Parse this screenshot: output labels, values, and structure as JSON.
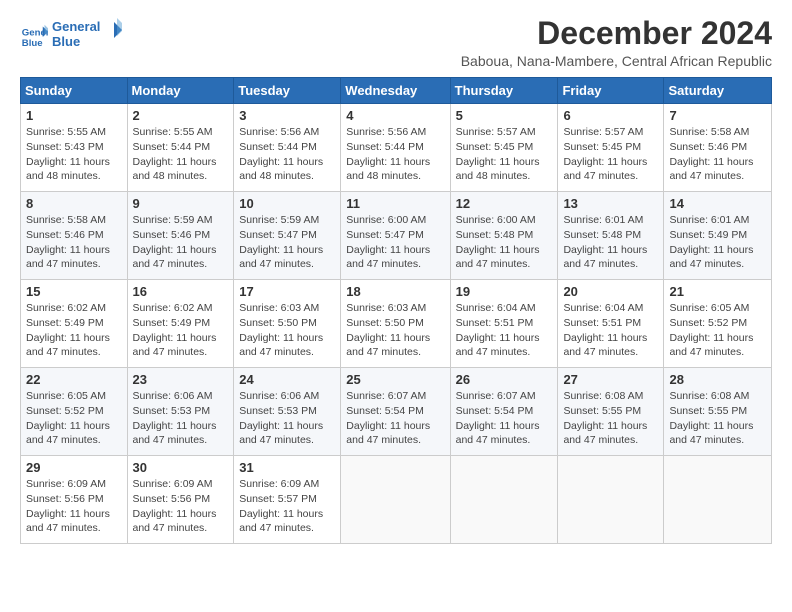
{
  "logo": {
    "line1": "General",
    "line2": "Blue"
  },
  "title": "December 2024",
  "subtitle": "Baboua, Nana-Mambere, Central African Republic",
  "weekdays": [
    "Sunday",
    "Monday",
    "Tuesday",
    "Wednesday",
    "Thursday",
    "Friday",
    "Saturday"
  ],
  "weeks": [
    [
      {
        "day": "1",
        "info": "Sunrise: 5:55 AM\nSunset: 5:43 PM\nDaylight: 11 hours\nand 48 minutes."
      },
      {
        "day": "2",
        "info": "Sunrise: 5:55 AM\nSunset: 5:44 PM\nDaylight: 11 hours\nand 48 minutes."
      },
      {
        "day": "3",
        "info": "Sunrise: 5:56 AM\nSunset: 5:44 PM\nDaylight: 11 hours\nand 48 minutes."
      },
      {
        "day": "4",
        "info": "Sunrise: 5:56 AM\nSunset: 5:44 PM\nDaylight: 11 hours\nand 48 minutes."
      },
      {
        "day": "5",
        "info": "Sunrise: 5:57 AM\nSunset: 5:45 PM\nDaylight: 11 hours\nand 48 minutes."
      },
      {
        "day": "6",
        "info": "Sunrise: 5:57 AM\nSunset: 5:45 PM\nDaylight: 11 hours\nand 47 minutes."
      },
      {
        "day": "7",
        "info": "Sunrise: 5:58 AM\nSunset: 5:46 PM\nDaylight: 11 hours\nand 47 minutes."
      }
    ],
    [
      {
        "day": "8",
        "info": "Sunrise: 5:58 AM\nSunset: 5:46 PM\nDaylight: 11 hours\nand 47 minutes."
      },
      {
        "day": "9",
        "info": "Sunrise: 5:59 AM\nSunset: 5:46 PM\nDaylight: 11 hours\nand 47 minutes."
      },
      {
        "day": "10",
        "info": "Sunrise: 5:59 AM\nSunset: 5:47 PM\nDaylight: 11 hours\nand 47 minutes."
      },
      {
        "day": "11",
        "info": "Sunrise: 6:00 AM\nSunset: 5:47 PM\nDaylight: 11 hours\nand 47 minutes."
      },
      {
        "day": "12",
        "info": "Sunrise: 6:00 AM\nSunset: 5:48 PM\nDaylight: 11 hours\nand 47 minutes."
      },
      {
        "day": "13",
        "info": "Sunrise: 6:01 AM\nSunset: 5:48 PM\nDaylight: 11 hours\nand 47 minutes."
      },
      {
        "day": "14",
        "info": "Sunrise: 6:01 AM\nSunset: 5:49 PM\nDaylight: 11 hours\nand 47 minutes."
      }
    ],
    [
      {
        "day": "15",
        "info": "Sunrise: 6:02 AM\nSunset: 5:49 PM\nDaylight: 11 hours\nand 47 minutes."
      },
      {
        "day": "16",
        "info": "Sunrise: 6:02 AM\nSunset: 5:49 PM\nDaylight: 11 hours\nand 47 minutes."
      },
      {
        "day": "17",
        "info": "Sunrise: 6:03 AM\nSunset: 5:50 PM\nDaylight: 11 hours\nand 47 minutes."
      },
      {
        "day": "18",
        "info": "Sunrise: 6:03 AM\nSunset: 5:50 PM\nDaylight: 11 hours\nand 47 minutes."
      },
      {
        "day": "19",
        "info": "Sunrise: 6:04 AM\nSunset: 5:51 PM\nDaylight: 11 hours\nand 47 minutes."
      },
      {
        "day": "20",
        "info": "Sunrise: 6:04 AM\nSunset: 5:51 PM\nDaylight: 11 hours\nand 47 minutes."
      },
      {
        "day": "21",
        "info": "Sunrise: 6:05 AM\nSunset: 5:52 PM\nDaylight: 11 hours\nand 47 minutes."
      }
    ],
    [
      {
        "day": "22",
        "info": "Sunrise: 6:05 AM\nSunset: 5:52 PM\nDaylight: 11 hours\nand 47 minutes."
      },
      {
        "day": "23",
        "info": "Sunrise: 6:06 AM\nSunset: 5:53 PM\nDaylight: 11 hours\nand 47 minutes."
      },
      {
        "day": "24",
        "info": "Sunrise: 6:06 AM\nSunset: 5:53 PM\nDaylight: 11 hours\nand 47 minutes."
      },
      {
        "day": "25",
        "info": "Sunrise: 6:07 AM\nSunset: 5:54 PM\nDaylight: 11 hours\nand 47 minutes."
      },
      {
        "day": "26",
        "info": "Sunrise: 6:07 AM\nSunset: 5:54 PM\nDaylight: 11 hours\nand 47 minutes."
      },
      {
        "day": "27",
        "info": "Sunrise: 6:08 AM\nSunset: 5:55 PM\nDaylight: 11 hours\nand 47 minutes."
      },
      {
        "day": "28",
        "info": "Sunrise: 6:08 AM\nSunset: 5:55 PM\nDaylight: 11 hours\nand 47 minutes."
      }
    ],
    [
      {
        "day": "29",
        "info": "Sunrise: 6:09 AM\nSunset: 5:56 PM\nDaylight: 11 hours\nand 47 minutes."
      },
      {
        "day": "30",
        "info": "Sunrise: 6:09 AM\nSunset: 5:56 PM\nDaylight: 11 hours\nand 47 minutes."
      },
      {
        "day": "31",
        "info": "Sunrise: 6:09 AM\nSunset: 5:57 PM\nDaylight: 11 hours\nand 47 minutes."
      },
      {
        "day": "",
        "info": ""
      },
      {
        "day": "",
        "info": ""
      },
      {
        "day": "",
        "info": ""
      },
      {
        "day": "",
        "info": ""
      }
    ]
  ]
}
